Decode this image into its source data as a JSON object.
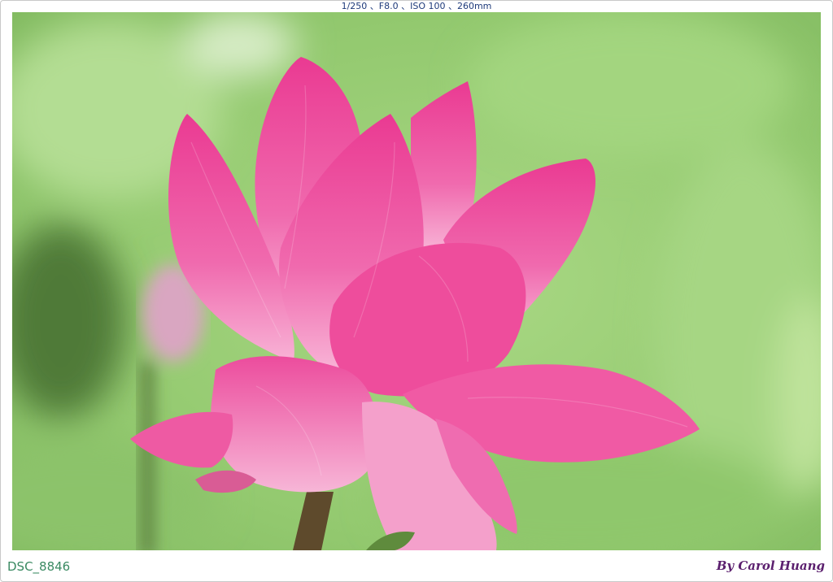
{
  "caption": {
    "exif": "1/250 、F8.0 、ISO 100 、260mm",
    "filename": "DSC_8846",
    "credit": "By Carol Huang"
  },
  "photo": {
    "subject": "pink lotus flower",
    "colors": {
      "background": "#9ed17a",
      "petal": "#f0559f",
      "petal_light": "#fbc6e0",
      "stem": "#5e4a2c"
    }
  }
}
